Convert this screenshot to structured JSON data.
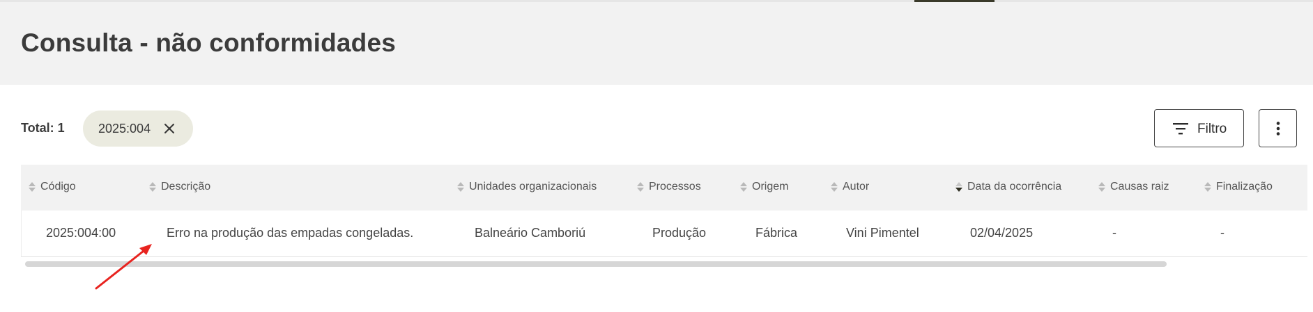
{
  "page": {
    "title": "Consulta - não conformidades"
  },
  "toolbar": {
    "total_label": "Total: 1",
    "filter_chip": "2025:004",
    "filter_button": "Filtro",
    "icons": {
      "filter": "filter-lines-icon",
      "more": "more-vertical-icon",
      "close": "close-icon",
      "sort": "sort-icon"
    }
  },
  "table": {
    "columns": [
      {
        "label": "Código",
        "sort": "none"
      },
      {
        "label": "Descrição",
        "sort": "none"
      },
      {
        "label": "Unidades organizacionais",
        "sort": "none"
      },
      {
        "label": "Processos",
        "sort": "none"
      },
      {
        "label": "Origem",
        "sort": "none"
      },
      {
        "label": "Autor",
        "sort": "none"
      },
      {
        "label": "Data da ocorrência",
        "sort": "descending"
      },
      {
        "label": "Causas raiz",
        "sort": "none"
      },
      {
        "label": "Finalização",
        "sort": "none"
      }
    ],
    "rows": [
      [
        "2025:004:00",
        "Erro na produção das empadas congeladas.",
        "Balneário Camboriú",
        "Produção",
        "Fábrica",
        "Vini Pimentel",
        "02/04/2025",
        "-",
        "-"
      ]
    ]
  },
  "colors": {
    "accent": "#3a3a2a",
    "chip_bg": "#ebebe0",
    "header_bg": "#f2f2f2",
    "annotation_arrow": "#e8231f"
  }
}
